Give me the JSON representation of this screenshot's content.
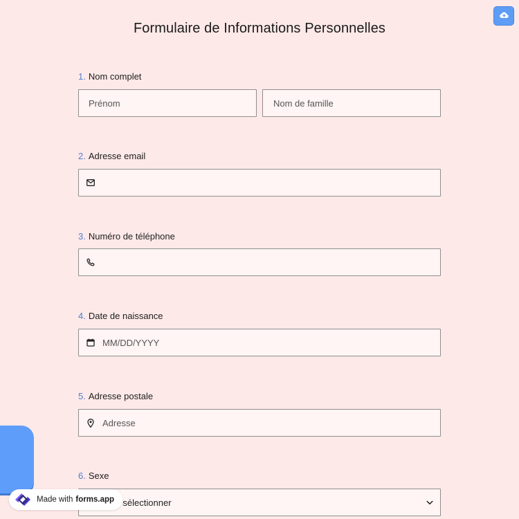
{
  "form": {
    "title": "Formulaire de Informations Personnelles"
  },
  "questions": [
    {
      "number": "1.",
      "label": "Nom complet",
      "first_placeholder": "Prénom",
      "last_placeholder": "Nom de famille"
    },
    {
      "number": "2.",
      "label": "Adresse email",
      "placeholder": "",
      "icon": "envelope-icon"
    },
    {
      "number": "3.",
      "label": "Numéro de téléphone",
      "placeholder": "",
      "icon": "phone-icon"
    },
    {
      "number": "4.",
      "label": "Date de naissance",
      "placeholder": "MM/DD/YYYY",
      "icon": "calendar-icon"
    },
    {
      "number": "5.",
      "label": "Adresse postale",
      "placeholder": "Adresse",
      "icon": "map-pin-icon"
    },
    {
      "number": "6.",
      "label": "Sexe",
      "selected": "Veuillez sélectionner",
      "icon": "chevron-down-icon"
    }
  ],
  "toolbar": {
    "save_icon": "cloud-upload-icon"
  },
  "branding": {
    "made_with": "Made with",
    "brand": "forms.app"
  },
  "colors": {
    "background": "#fde9e8",
    "accent": "#5e9df5",
    "number": "#4e7fd1"
  }
}
